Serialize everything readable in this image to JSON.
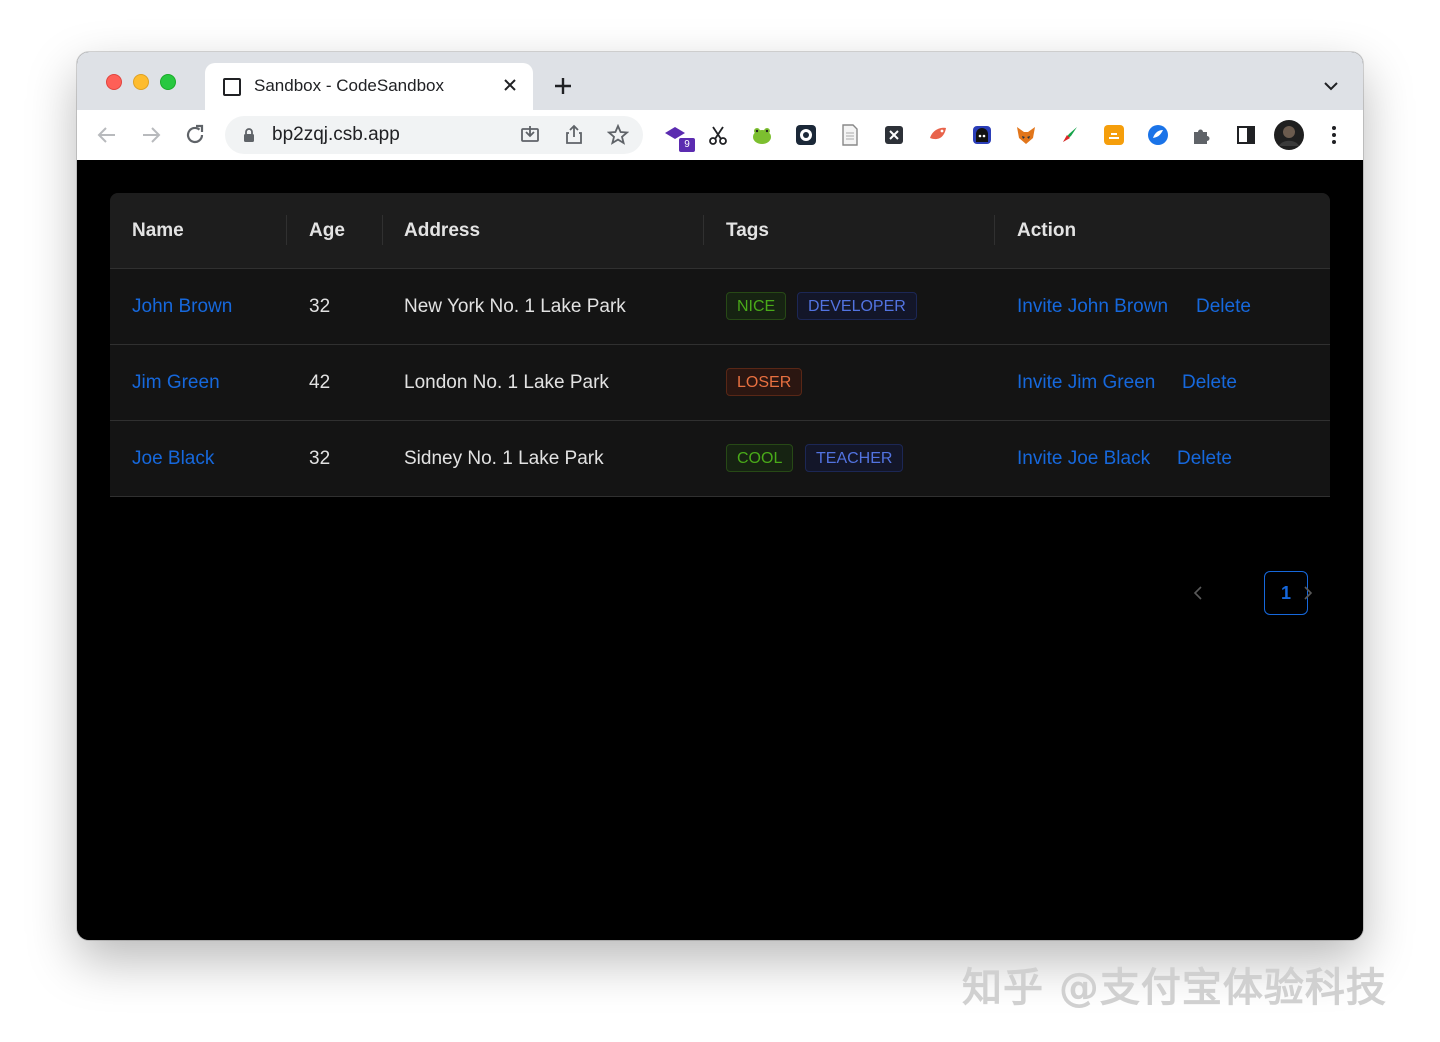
{
  "browser": {
    "tab_title": "Sandbox - CodeSandbox",
    "url": "bp2zqj.csb.app",
    "extension_badge": "9"
  },
  "table": {
    "columns": [
      "Name",
      "Age",
      "Address",
      "Tags",
      "Action"
    ],
    "rows": [
      {
        "name": "John Brown",
        "age": "32",
        "address": "New York No. 1 Lake Park",
        "tags": [
          {
            "label": "NICE",
            "color": "green"
          },
          {
            "label": "DEVELOPER",
            "color": "geekblue"
          }
        ],
        "invite": "Invite John Brown",
        "delete": "Delete"
      },
      {
        "name": "Jim Green",
        "age": "42",
        "address": "London No. 1 Lake Park",
        "tags": [
          {
            "label": "LOSER",
            "color": "volcano"
          }
        ],
        "invite": "Invite Jim Green",
        "delete": "Delete"
      },
      {
        "name": "Joe Black",
        "age": "32",
        "address": "Sidney No. 1 Lake Park",
        "tags": [
          {
            "label": "COOL",
            "color": "green"
          },
          {
            "label": "TEACHER",
            "color": "geekblue"
          }
        ],
        "invite": "Invite Joe Black",
        "delete": "Delete"
      }
    ]
  },
  "pagination": {
    "current_page": "1"
  },
  "watermark": "知乎 @支付宝体验科技",
  "colors": {
    "link": "#1668dc",
    "background": "#000000",
    "table": "#141414"
  }
}
